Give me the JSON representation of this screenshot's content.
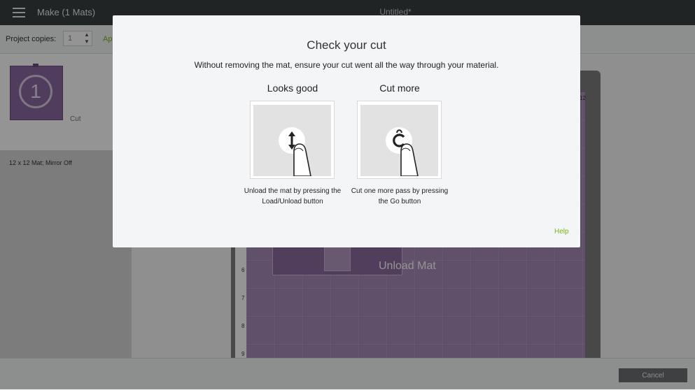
{
  "header": {
    "app_title": "Make (1 Mats)",
    "document_title": "Untitled*"
  },
  "toolbar": {
    "copies_label": "Project copies:",
    "copies_value": "1",
    "apply_label": "Ap"
  },
  "mat_list": {
    "items": [
      {
        "number": "1",
        "label": "Cut",
        "description": "12 x 12 Mat; Mirror Off"
      }
    ]
  },
  "canvas": {
    "status_text": "Unload Mat",
    "ruler_top": [
      "12"
    ],
    "ruler_left": [
      "6",
      "7",
      "8",
      "9"
    ]
  },
  "footer": {
    "cancel_label": "Cancel"
  },
  "modal": {
    "title": "Check your cut",
    "description": "Without removing the mat, ensure your cut went all the way through your material.",
    "options": [
      {
        "heading": "Looks good",
        "caption": "Unload the mat by pressing the Load/Unload button",
        "icon": "load-unload-arrows-icon"
      },
      {
        "heading": "Cut more",
        "caption": "Cut one more pass by pressing the Go button",
        "icon": "cricut-go-icon"
      }
    ],
    "help_label": "Help"
  },
  "colors": {
    "topbar": "#3a3e41",
    "mat_purple": "#a68bb6",
    "accent_green": "#7ab51d",
    "modal_bg": "#f4f5f6"
  }
}
